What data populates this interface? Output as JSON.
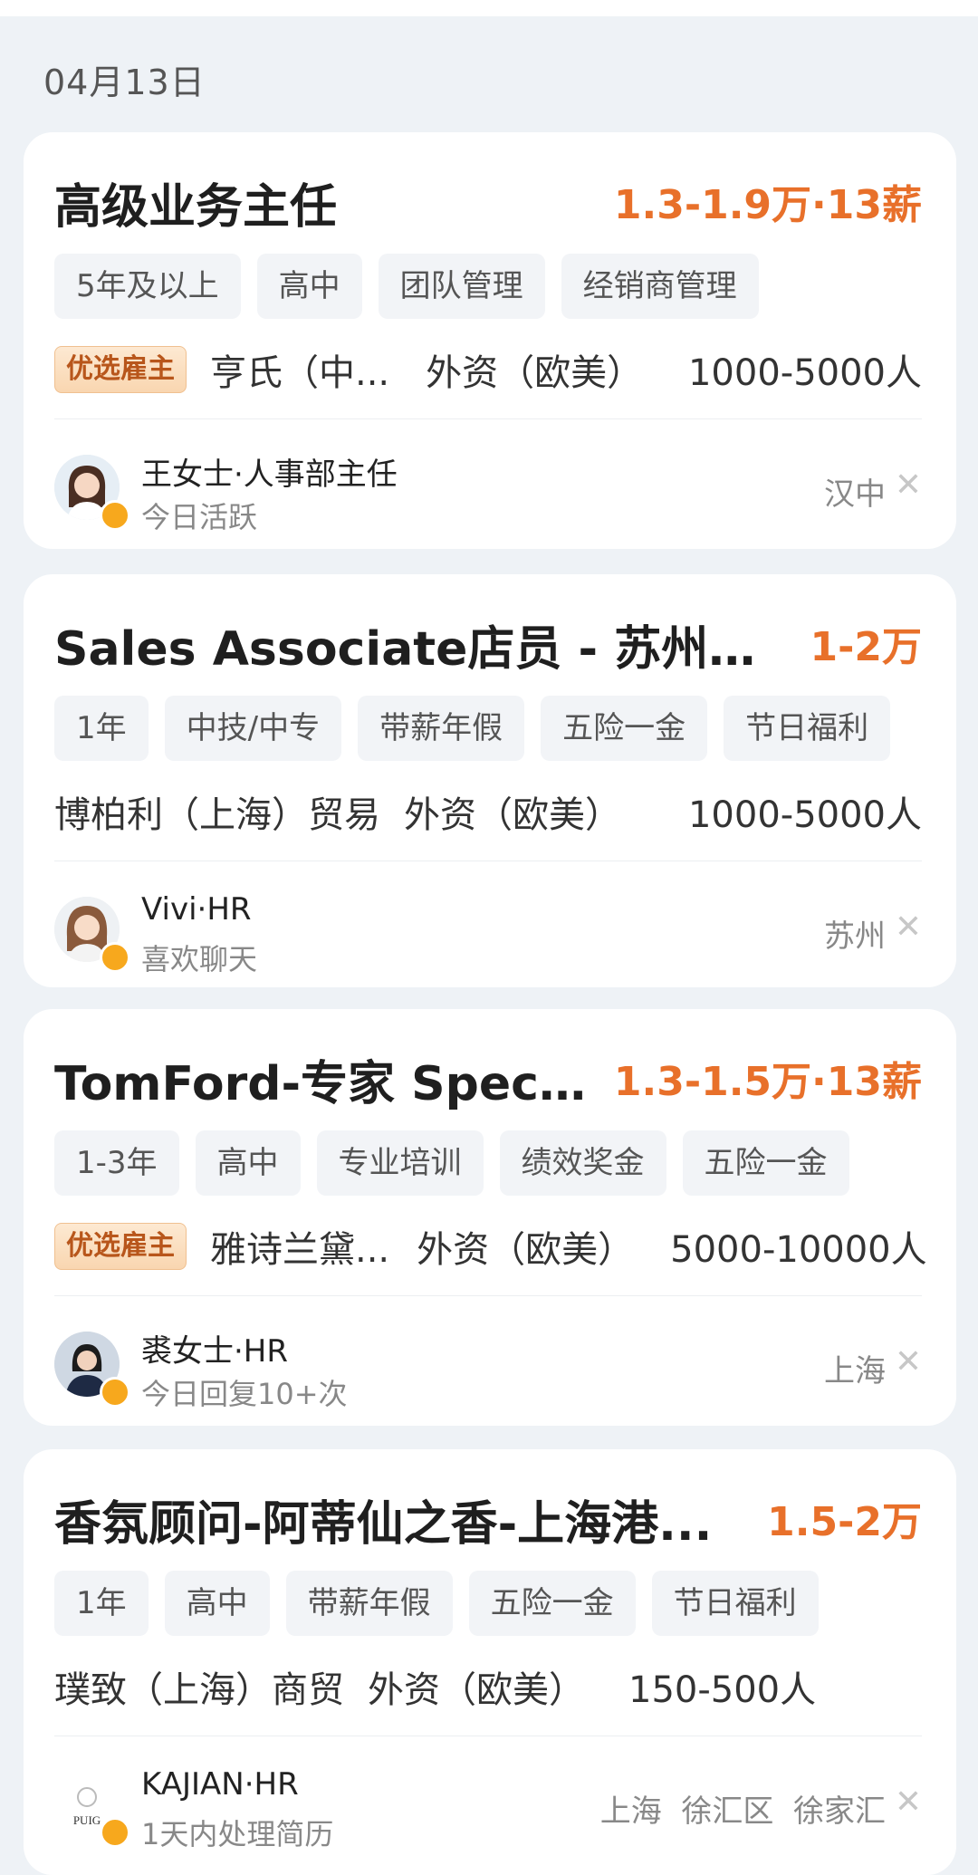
{
  "date_header": "04月13日",
  "jobs": [
    {
      "title": "高级业务主任",
      "salary": "1.3-1.9万·13薪",
      "tags": [
        "5年及以上",
        "高中",
        "团队管理",
        "经销商管理"
      ],
      "badge": "优选雇主",
      "company": "亨氏（中...",
      "company_type": "外资（欧美）",
      "company_size": "1000-5000人",
      "recruiter_name": "王女士·人事部主任",
      "recruiter_status": "今日活跃",
      "location": "汉中",
      "avatar_icon": "female-avatar-icon"
    },
    {
      "title": "Sales Associate店员 - 苏州比...",
      "salary": "1-2万",
      "tags": [
        "1年",
        "中技/中专",
        "带薪年假",
        "五险一金",
        "节日福利"
      ],
      "badge": "",
      "company": "博柏利（上海）贸易",
      "company_type": "外资（欧美）",
      "company_size": "1000-5000人",
      "recruiter_name": "Vivi·HR",
      "recruiter_status": "喜欢聊天",
      "location": "苏州",
      "avatar_icon": "female-avatar-icon"
    },
    {
      "title": "TomFord-专家 Speci...",
      "salary": "1.3-1.5万·13薪",
      "tags": [
        "1-3年",
        "高中",
        "专业培训",
        "绩效奖金",
        "五险一金"
      ],
      "badge": "优选雇主",
      "company": "雅诗兰黛...",
      "company_type": "外资（欧美）",
      "company_size": "5000-10000人",
      "recruiter_name": "裘女士·HR",
      "recruiter_status": "今日回复10+次",
      "location": "上海",
      "avatar_icon": "photo-avatar-icon"
    },
    {
      "title": "香氛顾问-阿蒂仙之香-上海港...",
      "salary": "1.5-2万",
      "tags": [
        "1年",
        "高中",
        "带薪年假",
        "五险一金",
        "节日福利"
      ],
      "badge": "",
      "company": "璞致（上海）商贸",
      "company_type": "外资（欧美）",
      "company_size": "150-500人",
      "recruiter_name": "KAJIAN·HR",
      "recruiter_status": "1天内处理简历",
      "location": "上海  徐汇区  徐家汇",
      "avatar_icon": "puig-logo-icon",
      "avatar_logo_text": "PUIG"
    }
  ],
  "colors": {
    "salary": "#e8702a",
    "online_dot": "#f7a81d",
    "background": "#eef2f6"
  }
}
